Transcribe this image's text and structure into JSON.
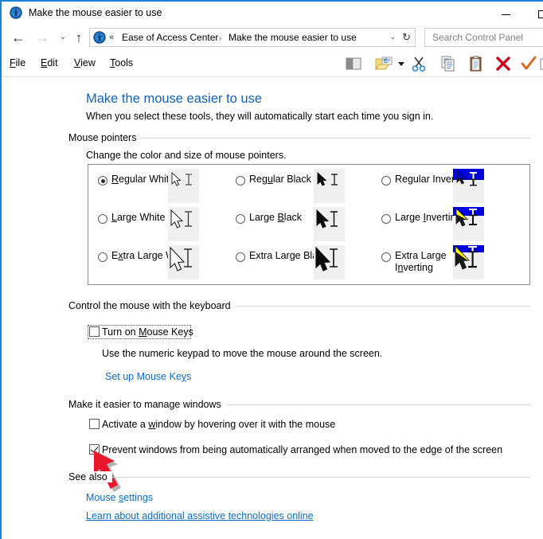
{
  "window": {
    "title": "Make the mouse easier to use",
    "icon": "ease-of-access-icon",
    "minimize_label": "−",
    "maximize_label": "□",
    "accent_color": "#1883d7"
  },
  "nav": {
    "back_glyph": "←",
    "forward_glyph": "→",
    "recent_glyph": "ⱟ",
    "up_glyph": "↑",
    "address_chevrons": "«",
    "crumb_separator": "›",
    "breadcrumbs": [
      "Ease of Access Center",
      "Make the mouse easier to use"
    ],
    "dropdown_glyph": "⌄",
    "refresh_glyph": "↻"
  },
  "search": {
    "placeholder": "Search Control Panel",
    "value": ""
  },
  "menubar": {
    "items": [
      {
        "label": "File",
        "accel": "F"
      },
      {
        "label": "Edit",
        "accel": "E"
      },
      {
        "label": "View",
        "accel": "V"
      },
      {
        "label": "Tools",
        "accel": "T"
      }
    ]
  },
  "toolbar": {
    "icons": [
      "preview-pane-icon",
      "new-folder-icon",
      "dropdown-arrow-icon",
      "cut-scissors-icon",
      "copy-icon",
      "paste-icon",
      "delete-x-icon",
      "confirm-check-icon",
      "partial-icon"
    ]
  },
  "page": {
    "title": "Make the mouse easier to use",
    "subtitle": "When you select these tools, they will automatically start each time you sign in."
  },
  "sections": {
    "mouse_pointers": {
      "heading": "Mouse pointers",
      "description": "Change the color and size of mouse pointers.",
      "options": [
        {
          "label": "Regular White",
          "accel": "R",
          "selected": true,
          "style": "white"
        },
        {
          "label": "Large White",
          "accel": "L",
          "selected": false,
          "style": "white"
        },
        {
          "label": "Extra Large White",
          "accel": "x",
          "selected": false,
          "style": "white"
        },
        {
          "label": "Regular Black",
          "accel": "u",
          "selected": false,
          "style": "black"
        },
        {
          "label": "Large Black",
          "accel": "B",
          "selected": false,
          "style": "black"
        },
        {
          "label": "Extra Large Black",
          "accel": "k",
          "selected": false,
          "style": "black"
        },
        {
          "label": "Regular Inverting",
          "accel": "",
          "selected": false,
          "style": "inverting"
        },
        {
          "label": "Large Inverting",
          "accel": "I",
          "selected": false,
          "style": "inverting"
        },
        {
          "label": "Extra Large Inverting",
          "accel": "n",
          "selected": false,
          "style": "inverting"
        }
      ]
    },
    "keyboard_control": {
      "heading": "Control the mouse with the keyboard",
      "checkbox_label": "Turn on Mouse Keys",
      "checkbox_accel": "M",
      "checkbox_checked": false,
      "checkbox_focused": true,
      "description": "Use the numeric keypad to move the mouse around the screen.",
      "link": "Set up Mouse Keys"
    },
    "manage_windows": {
      "heading": "Make it easier to manage windows",
      "items": [
        {
          "label": "Activate a window by hovering over it with the mouse",
          "accel": "w",
          "checked": false
        },
        {
          "label": "Prevent windows from being automatically arranged when moved to the edge of the screen",
          "accel": "",
          "checked": true
        }
      ]
    },
    "see_also": {
      "heading": "See also",
      "links": [
        {
          "text": "Mouse settings",
          "accel": "s",
          "underline": false
        },
        {
          "text": "Learn about additional assistive technologies online",
          "accel": "",
          "underline": true
        }
      ]
    }
  },
  "annotation": {
    "arrow": "red-pointer-arrow",
    "color": "#e8172b"
  },
  "colors": {
    "link": "#0a6cc4",
    "title": "#1262b5",
    "panel_border": "#8d8d8d",
    "rule": "#d6d6d6",
    "preview_bg": "#efefef",
    "invert_blue": "#0000dd",
    "invert_yellow": "#ffff00"
  }
}
